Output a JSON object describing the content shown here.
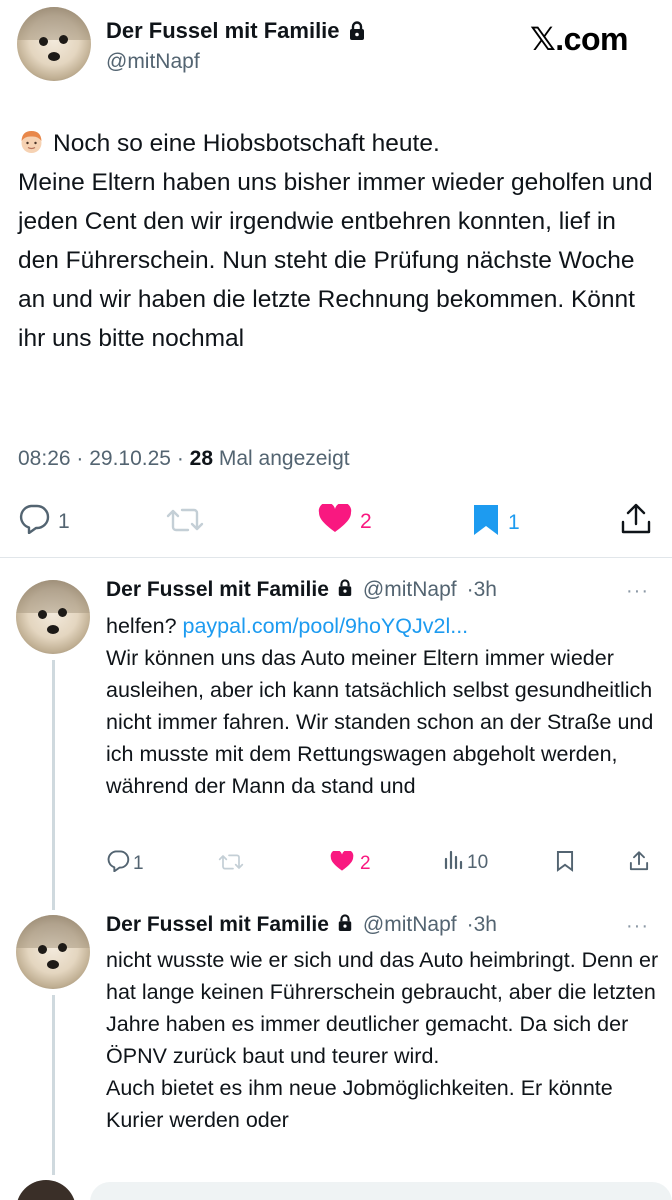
{
  "site_logo": "𝕏.com",
  "main_tweet": {
    "display_name": "Der Fussel mit Familie",
    "handle": "@mitNapf",
    "emoji": "person-face-emoji",
    "text_first_line": "Noch so eine Hiobsbotschaft heute.",
    "text_rest": "Meine Eltern haben uns bisher immer wieder geholfen und jeden Cent den wir irgendwie entbehren konnten, lief in den Führerschein. Nun steht die Prüfung nächste Woche an und wir haben die letzte Rechnung bekommen. Könnt ihr uns bitte nochmal",
    "time": "08:26",
    "date": "29.10.25",
    "views_count": "28",
    "views_label": "Mal angezeigt",
    "actions": {
      "replies": "1",
      "likes": "2",
      "bookmarks": "1"
    },
    "colors": {
      "like": "#f91880",
      "bookmark": "#1d9bf0"
    }
  },
  "replies": [
    {
      "display_name": "Der Fussel mit Familie",
      "handle": "@mitNapf",
      "age": "3h",
      "link_prefix": "helfen? ",
      "link": "paypal.com/pool/9hoYQJv2l...",
      "text": "Wir können uns das Auto meiner Eltern immer wieder ausleihen, aber ich kann tatsächlich selbst gesundheitlich nicht immer fahren. Wir standen schon an der Straße und ich musste mit dem Rettungswagen abgeholt werden, während der Mann da stand und",
      "actions": {
        "replies": "1",
        "likes": "2",
        "views": "10"
      }
    },
    {
      "display_name": "Der Fussel mit Familie",
      "handle": "@mitNapf",
      "age": "3h",
      "text": "nicht wusste wie er sich und das Auto heimbringt. Denn er hat lange keinen Führerschein gebraucht, aber die letzten Jahre haben es immer deutlicher gemacht. Da sich der ÖPNV zurück baut und teurer wird.\nAuch bietet es ihm neue Jobmöglichkeiten. Er könnte Kurier werden oder"
    }
  ],
  "more_icon": "···"
}
